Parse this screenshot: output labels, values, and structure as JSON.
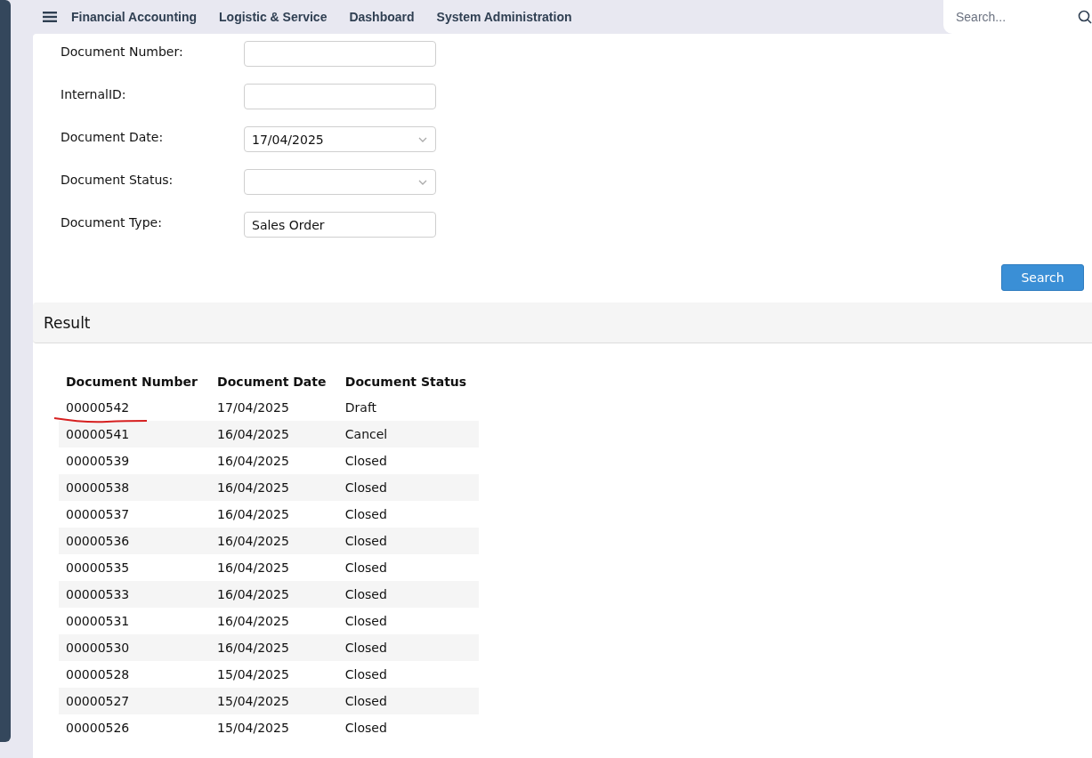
{
  "nav": {
    "items": [
      "Financial Accounting",
      "Logistic & Service",
      "Dashboard",
      "System Administration"
    ],
    "search": {
      "placeholder": "Search..."
    }
  },
  "form": {
    "fields": [
      {
        "label": "Document Number:",
        "kind": "text"
      },
      {
        "label": "InternalID:",
        "kind": "text"
      },
      {
        "label": "Document Date:",
        "kind": "select",
        "value": "17/04/2025"
      },
      {
        "label": "Document Status:",
        "kind": "select"
      },
      {
        "label": "Document Type:",
        "kind": "text",
        "value": "Sales Order"
      }
    ],
    "button": "Search"
  },
  "result": {
    "title": "Result",
    "columns": [
      "Document Number",
      "Document Date",
      "Document Status"
    ],
    "rows": [
      [
        "00000542",
        "17/04/2025",
        "Draft"
      ],
      [
        "00000541",
        "16/04/2025",
        "Cancel"
      ],
      [
        "00000539",
        "16/04/2025",
        "Closed"
      ],
      [
        "00000538",
        "16/04/2025",
        "Closed"
      ],
      [
        "00000537",
        "16/04/2025",
        "Closed"
      ],
      [
        "00000536",
        "16/04/2025",
        "Closed"
      ],
      [
        "00000535",
        "16/04/2025",
        "Closed"
      ],
      [
        "00000533",
        "16/04/2025",
        "Closed"
      ],
      [
        "00000531",
        "16/04/2025",
        "Closed"
      ],
      [
        "00000530",
        "16/04/2025",
        "Closed"
      ],
      [
        "00000528",
        "15/04/2025",
        "Closed"
      ],
      [
        "00000527",
        "15/04/2025",
        "Closed"
      ],
      [
        "00000526",
        "15/04/2025",
        "Closed"
      ]
    ]
  }
}
